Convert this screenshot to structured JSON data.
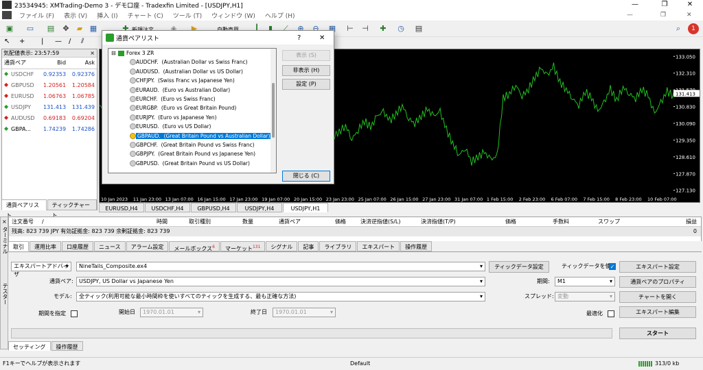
{
  "window": {
    "title": "23534945: XMTrading-Demo 3 - デモ口座 - Tradexfin Limited - [USDJPY,H1]",
    "minimize": "—",
    "restore": "❐",
    "close": "✕"
  },
  "menu": [
    "ファイル (F)",
    "表示 (V)",
    "挿入 (I)",
    "チャート (C)",
    "ツール (T)",
    "ウィンドウ (W)",
    "ヘルプ (H)"
  ],
  "toolbar": {
    "new_order": "新規注文",
    "auto_trade": "自動売買",
    "notification_count": "1"
  },
  "market_watch": {
    "header": "気配値表示: 23:57:59",
    "columns": [
      "通貨ペア",
      "Bid",
      "Ask"
    ],
    "rows": [
      {
        "symbol": "USDCHF",
        "bid": "0.92353",
        "ask": "0.92376",
        "dir": "up"
      },
      {
        "symbol": "GBPUSD",
        "bid": "1.20561",
        "ask": "1.20584",
        "dir": "down"
      },
      {
        "symbol": "EURUSD",
        "bid": "1.06763",
        "ask": "1.06785",
        "dir": "down"
      },
      {
        "symbol": "USDJPY",
        "bid": "131.413",
        "ask": "131.439",
        "dir": "up"
      },
      {
        "symbol": "AUDUSD",
        "bid": "0.69183",
        "ask": "0.69204",
        "dir": "down"
      },
      {
        "symbol": "GBPA...",
        "bid": "1.74239",
        "ask": "1.74286",
        "dir": "up"
      }
    ],
    "tabs": [
      "通貨ペアリスト",
      "ティックチャート"
    ]
  },
  "chart": {
    "price_labels": [
      "133.050",
      "132.310",
      "131.570",
      "131.413",
      "130.830",
      "130.090",
      "129.350",
      "128.610",
      "127.870",
      "127.130"
    ],
    "current_price": "131.413",
    "time_labels": [
      "10 Jan 2023",
      "11 Jan 23:00",
      "13 Jan 07:00",
      "16 Jan 15:00",
      "17 Jan 23:00",
      "19 Jan 07:00",
      "20 Jan 15:00",
      "23 Jan 23:00",
      "25 Jan 07:00",
      "26 Jan 15:00",
      "27 Jan 23:00",
      "31 Jan 07:00",
      "1 Feb 15:00",
      "2 Feb 23:00",
      "6 Feb 07:00",
      "7 Feb 15:00",
      "8 Feb 23:00",
      "10 Feb 07:00"
    ],
    "tabs": [
      "EURUSD,H4",
      "USDCHF,H4",
      "GBPUSD,H4",
      "USDJPY,H4",
      "USDJPY,H1"
    ],
    "active_tab": 4
  },
  "chart_data": {
    "type": "line",
    "series": [
      {
        "values": [
          130.9,
          130.5,
          130.7,
          131.0,
          130.4,
          130.7,
          130.2,
          130.4,
          129.8,
          130.1,
          129.4,
          128.9,
          128.6,
          129.2,
          128.8,
          128.3,
          128.5,
          128.2,
          128.7,
          129.3,
          128.9,
          129.6,
          130.1,
          129.7,
          130.4,
          130.6,
          130.0,
          130.3,
          130.8,
          130.2,
          130.4,
          130.0,
          130.2,
          129.8,
          130.0,
          129.6,
          129.9,
          129.5,
          129.7,
          130.0,
          129.4,
          129.8,
          130.2,
          129.9,
          130.4,
          130.6,
          130.2,
          130.5,
          130.9,
          130.3,
          130.1,
          130.4,
          130.7,
          130.4,
          130.6,
          129.8,
          129.2,
          128.7,
          129.0,
          128.4,
          128.6,
          128.8,
          128.5,
          128.6,
          131.2,
          131.4,
          131.8,
          131.3,
          131.6,
          132.1,
          132.5,
          132.2,
          132.6,
          131.9,
          131.6,
          131.2,
          130.9,
          131.5,
          131.2,
          130.6,
          131.0,
          131.6,
          131.1,
          131.7,
          131.4,
          131.2,
          131.6,
          131.3,
          130.5,
          131.0,
          131.5,
          131.3
        ]
      }
    ],
    "ylim": [
      127.0,
      133.3
    ],
    "grid": false
  },
  "terminal": {
    "side_label": "ターミナル",
    "columns": [
      "注文番号",
      "/",
      "時間",
      "取引種別",
      "数量",
      "通貨ペア",
      "価格",
      "決済逆指値(S/L)",
      "決済指値(T/P)",
      "価格",
      "手数料",
      "スワップ",
      "損益"
    ],
    "balance": "残高: 823 739 JPY  有効証拠金: 823 739  余剰証拠金: 823 739",
    "balance_value": "0",
    "tabs": [
      "取引",
      "運用比率",
      "口座履歴",
      "ニュース",
      "アラーム設定",
      "メールボックス",
      "マーケット",
      "シグナル",
      "記事",
      "ライブラリ",
      "エキスパート",
      "操作履歴"
    ],
    "mailbox_badge": "6",
    "market_badge": "131"
  },
  "tester": {
    "side_label": "テスター",
    "type_value": "エキスパートアドバイザ",
    "ea_value": "NineTails_Composite.ex4",
    "symbol_label": "通貨ペア:",
    "symbol_value": "USDJPY, US Dollar vs Japanese Yen",
    "model_label": "モデル:",
    "model_value": "全ティック(利用可能な最小時間枠を使いすべてのティックを生成する、最も正確な方法)",
    "use_date_label": "期間を指定",
    "from_label": "開始日",
    "from_value": "1970.01.01",
    "to_label": "終了日",
    "to_value": "1970.01.01",
    "tick_data_settings": "ティックデータ設定",
    "use_tick_data": "ティックデータを使う",
    "period_label": "期間:",
    "period_value": "M1",
    "spread_label": "スプレッド:",
    "spread_value": "変動",
    "optimize_label": "最適化",
    "buttons": {
      "expert_settings": "エキスパート設定",
      "symbol_props": "通貨ペアのプロパティ",
      "open_chart": "チャートを開く",
      "modify_expert": "エキスパート編集",
      "start": "スタート"
    },
    "tabs": [
      "セッティング",
      "操作履歴"
    ]
  },
  "status": {
    "help": "F1キーでヘルプが表示されます",
    "profile": "Default",
    "traffic": "313/0 kb"
  },
  "dialog": {
    "title": "通貨ペアリスト",
    "help": "?",
    "close": "✕",
    "group": "Forex 3 ZR",
    "items": [
      {
        "symbol": "AUDCHF.",
        "desc": "(Australian Dollar vs Swiss Franc)"
      },
      {
        "symbol": "AUDUSD.",
        "desc": "(Australian Dollar vs US Dollar)"
      },
      {
        "symbol": "CHFJPY.",
        "desc": "(Swiss Franc vs Japanese Yen)"
      },
      {
        "symbol": "EURAUD.",
        "desc": "(Euro vs Australian Dollar)"
      },
      {
        "symbol": "EURCHF.",
        "desc": "(Euro vs Swiss Franc)"
      },
      {
        "symbol": "EURGBP.",
        "desc": "(Euro vs Great Britain Pound)"
      },
      {
        "symbol": "EURJPY.",
        "desc": "(Euro vs Japanese Yen)"
      },
      {
        "symbol": "EURUSD.",
        "desc": "(Euro vs US Dollar)"
      },
      {
        "symbol": "GBPAUD.",
        "desc": "(Great Britain Pound vs Australian Dollar)",
        "selected": true
      },
      {
        "symbol": "GBPCHF.",
        "desc": "(Great Britain Pound vs Swiss Franc)"
      },
      {
        "symbol": "GBPJPY.",
        "desc": "(Great Britain Pound vs Japanese Yen)"
      },
      {
        "symbol": "GBPUSD.",
        "desc": "(Great Britain Pound vs US Dollar)"
      }
    ],
    "buttons": {
      "show": "表示 (S)",
      "hide": "非表示 (H)",
      "props": "設定 (P)",
      "close": "閉じる (C)"
    }
  }
}
